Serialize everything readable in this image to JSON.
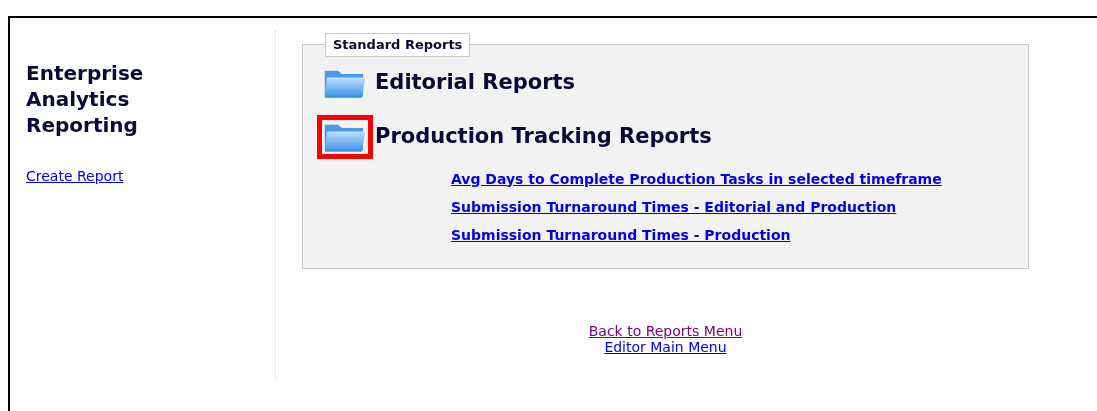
{
  "sidebar": {
    "title": "Enterprise Analytics Reporting",
    "links": [
      {
        "label": "Create Report",
        "visited": false
      }
    ]
  },
  "standard_reports": {
    "legend": "Standard Reports",
    "folders": [
      {
        "label": "Editorial Reports",
        "highlighted": false
      },
      {
        "label": "Production Tracking Reports",
        "highlighted": true,
        "reports": [
          "Avg Days to Complete Production Tasks in selected timeframe",
          "Submission Turnaround Times - Editorial and Production",
          "Submission Turnaround Times - Production"
        ]
      }
    ]
  },
  "footer_links": [
    {
      "label": "Back to Reports Menu",
      "visited": true
    },
    {
      "label": "Editor Main Menu",
      "visited": false
    }
  ]
}
